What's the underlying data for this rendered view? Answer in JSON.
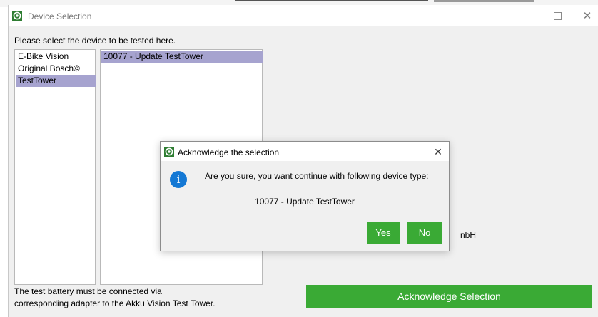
{
  "window": {
    "title": "Device Selection",
    "minimize_glyph": "",
    "close_glyph": "✕"
  },
  "main": {
    "prompt": "Please select the device to be tested here.",
    "categories": [
      {
        "label": "E-Bike Vision",
        "selected": false
      },
      {
        "label": "Original Bosch©",
        "selected": false
      },
      {
        "label": "TestTower",
        "selected": true
      }
    ],
    "devices": [
      {
        "label": "10077 - Update TestTower",
        "selected": true
      }
    ],
    "hint_line1": "The test battery must be connected via",
    "hint_line2": "corresponding adapter to the Akku Vision Test Tower.",
    "acknowledge_label": "Acknowledge Selection",
    "background_fragment": "nbH"
  },
  "dialog": {
    "title": "Acknowledge the selection",
    "close_glyph": "✕",
    "info_glyph": "i",
    "message": "Are you sure, you want continue with following device type:",
    "device": "10077 - Update TestTower",
    "yes_label": "Yes",
    "no_label": "No"
  },
  "colors": {
    "accent_green": "#3aaa35",
    "selection": "#a6a3cf",
    "info_blue": "#1478d4"
  },
  "icons": {
    "app": "akku-vision-logo-icon",
    "info": "info-icon"
  }
}
